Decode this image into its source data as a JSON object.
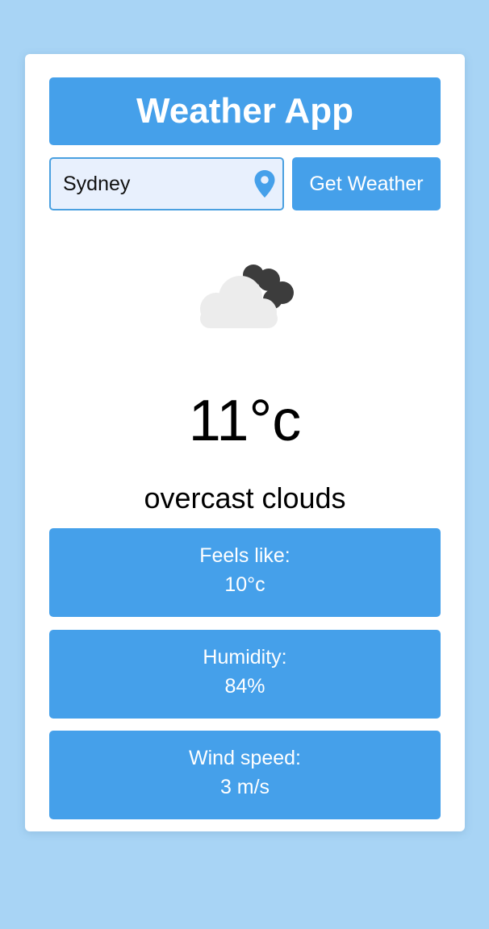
{
  "app": {
    "title": "Weather App"
  },
  "search": {
    "value": "Sydney",
    "placeholder": "",
    "icon": "location-pin-icon",
    "button_label": "Get Weather"
  },
  "weather": {
    "icon": "overcast-clouds-icon",
    "temperature": "11°c",
    "description": "overcast clouds"
  },
  "stats": [
    {
      "label": "Feels like:",
      "value": "10°c"
    },
    {
      "label": "Humidity:",
      "value": "84%"
    },
    {
      "label": "Wind speed:",
      "value": "3 m/s"
    }
  ],
  "colors": {
    "background": "#a8d4f5",
    "accent": "#45a0ea",
    "input_background": "#e8f0fd",
    "card": "#ffffff"
  }
}
